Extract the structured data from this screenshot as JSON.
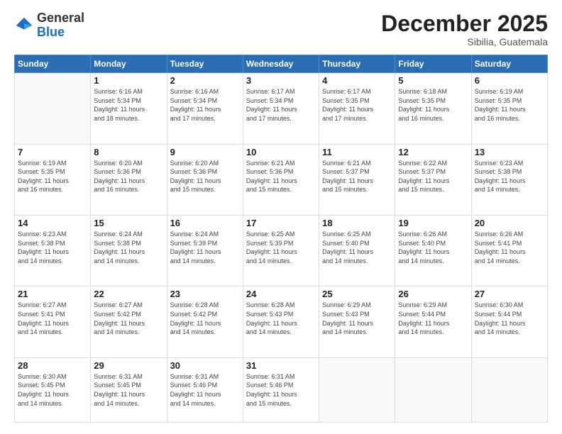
{
  "logo": {
    "general": "General",
    "blue": "Blue"
  },
  "header": {
    "month": "December 2025",
    "location": "Sibilia, Guatemala"
  },
  "weekdays": [
    "Sunday",
    "Monday",
    "Tuesday",
    "Wednesday",
    "Thursday",
    "Friday",
    "Saturday"
  ],
  "weeks": [
    [
      {
        "day": "",
        "info": ""
      },
      {
        "day": "1",
        "info": "Sunrise: 6:16 AM\nSunset: 5:34 PM\nDaylight: 11 hours\nand 18 minutes."
      },
      {
        "day": "2",
        "info": "Sunrise: 6:16 AM\nSunset: 5:34 PM\nDaylight: 11 hours\nand 17 minutes."
      },
      {
        "day": "3",
        "info": "Sunrise: 6:17 AM\nSunset: 5:34 PM\nDaylight: 11 hours\nand 17 minutes."
      },
      {
        "day": "4",
        "info": "Sunrise: 6:17 AM\nSunset: 5:35 PM\nDaylight: 11 hours\nand 17 minutes."
      },
      {
        "day": "5",
        "info": "Sunrise: 6:18 AM\nSunset: 5:35 PM\nDaylight: 11 hours\nand 16 minutes."
      },
      {
        "day": "6",
        "info": "Sunrise: 6:19 AM\nSunset: 5:35 PM\nDaylight: 11 hours\nand 16 minutes."
      }
    ],
    [
      {
        "day": "7",
        "info": "Sunrise: 6:19 AM\nSunset: 5:35 PM\nDaylight: 11 hours\nand 16 minutes."
      },
      {
        "day": "8",
        "info": "Sunrise: 6:20 AM\nSunset: 5:36 PM\nDaylight: 11 hours\nand 16 minutes."
      },
      {
        "day": "9",
        "info": "Sunrise: 6:20 AM\nSunset: 5:36 PM\nDaylight: 11 hours\nand 15 minutes."
      },
      {
        "day": "10",
        "info": "Sunrise: 6:21 AM\nSunset: 5:36 PM\nDaylight: 11 hours\nand 15 minutes."
      },
      {
        "day": "11",
        "info": "Sunrise: 6:21 AM\nSunset: 5:37 PM\nDaylight: 11 hours\nand 15 minutes."
      },
      {
        "day": "12",
        "info": "Sunrise: 6:22 AM\nSunset: 5:37 PM\nDaylight: 11 hours\nand 15 minutes."
      },
      {
        "day": "13",
        "info": "Sunrise: 6:23 AM\nSunset: 5:38 PM\nDaylight: 11 hours\nand 14 minutes."
      }
    ],
    [
      {
        "day": "14",
        "info": "Sunrise: 6:23 AM\nSunset: 5:38 PM\nDaylight: 11 hours\nand 14 minutes."
      },
      {
        "day": "15",
        "info": "Sunrise: 6:24 AM\nSunset: 5:38 PM\nDaylight: 11 hours\nand 14 minutes."
      },
      {
        "day": "16",
        "info": "Sunrise: 6:24 AM\nSunset: 5:39 PM\nDaylight: 11 hours\nand 14 minutes."
      },
      {
        "day": "17",
        "info": "Sunrise: 6:25 AM\nSunset: 5:39 PM\nDaylight: 11 hours\nand 14 minutes."
      },
      {
        "day": "18",
        "info": "Sunrise: 6:25 AM\nSunset: 5:40 PM\nDaylight: 11 hours\nand 14 minutes."
      },
      {
        "day": "19",
        "info": "Sunrise: 6:26 AM\nSunset: 5:40 PM\nDaylight: 11 hours\nand 14 minutes."
      },
      {
        "day": "20",
        "info": "Sunrise: 6:26 AM\nSunset: 5:41 PM\nDaylight: 11 hours\nand 14 minutes."
      }
    ],
    [
      {
        "day": "21",
        "info": "Sunrise: 6:27 AM\nSunset: 5:41 PM\nDaylight: 11 hours\nand 14 minutes."
      },
      {
        "day": "22",
        "info": "Sunrise: 6:27 AM\nSunset: 5:42 PM\nDaylight: 11 hours\nand 14 minutes."
      },
      {
        "day": "23",
        "info": "Sunrise: 6:28 AM\nSunset: 5:42 PM\nDaylight: 11 hours\nand 14 minutes."
      },
      {
        "day": "24",
        "info": "Sunrise: 6:28 AM\nSunset: 5:43 PM\nDaylight: 11 hours\nand 14 minutes."
      },
      {
        "day": "25",
        "info": "Sunrise: 6:29 AM\nSunset: 5:43 PM\nDaylight: 11 hours\nand 14 minutes."
      },
      {
        "day": "26",
        "info": "Sunrise: 6:29 AM\nSunset: 5:44 PM\nDaylight: 11 hours\nand 14 minutes."
      },
      {
        "day": "27",
        "info": "Sunrise: 6:30 AM\nSunset: 5:44 PM\nDaylight: 11 hours\nand 14 minutes."
      }
    ],
    [
      {
        "day": "28",
        "info": "Sunrise: 6:30 AM\nSunset: 5:45 PM\nDaylight: 11 hours\nand 14 minutes."
      },
      {
        "day": "29",
        "info": "Sunrise: 6:31 AM\nSunset: 5:45 PM\nDaylight: 11 hours\nand 14 minutes."
      },
      {
        "day": "30",
        "info": "Sunrise: 6:31 AM\nSunset: 5:46 PM\nDaylight: 11 hours\nand 14 minutes."
      },
      {
        "day": "31",
        "info": "Sunrise: 6:31 AM\nSunset: 5:46 PM\nDaylight: 11 hours\nand 15 minutes."
      },
      {
        "day": "",
        "info": ""
      },
      {
        "day": "",
        "info": ""
      },
      {
        "day": "",
        "info": ""
      }
    ]
  ]
}
